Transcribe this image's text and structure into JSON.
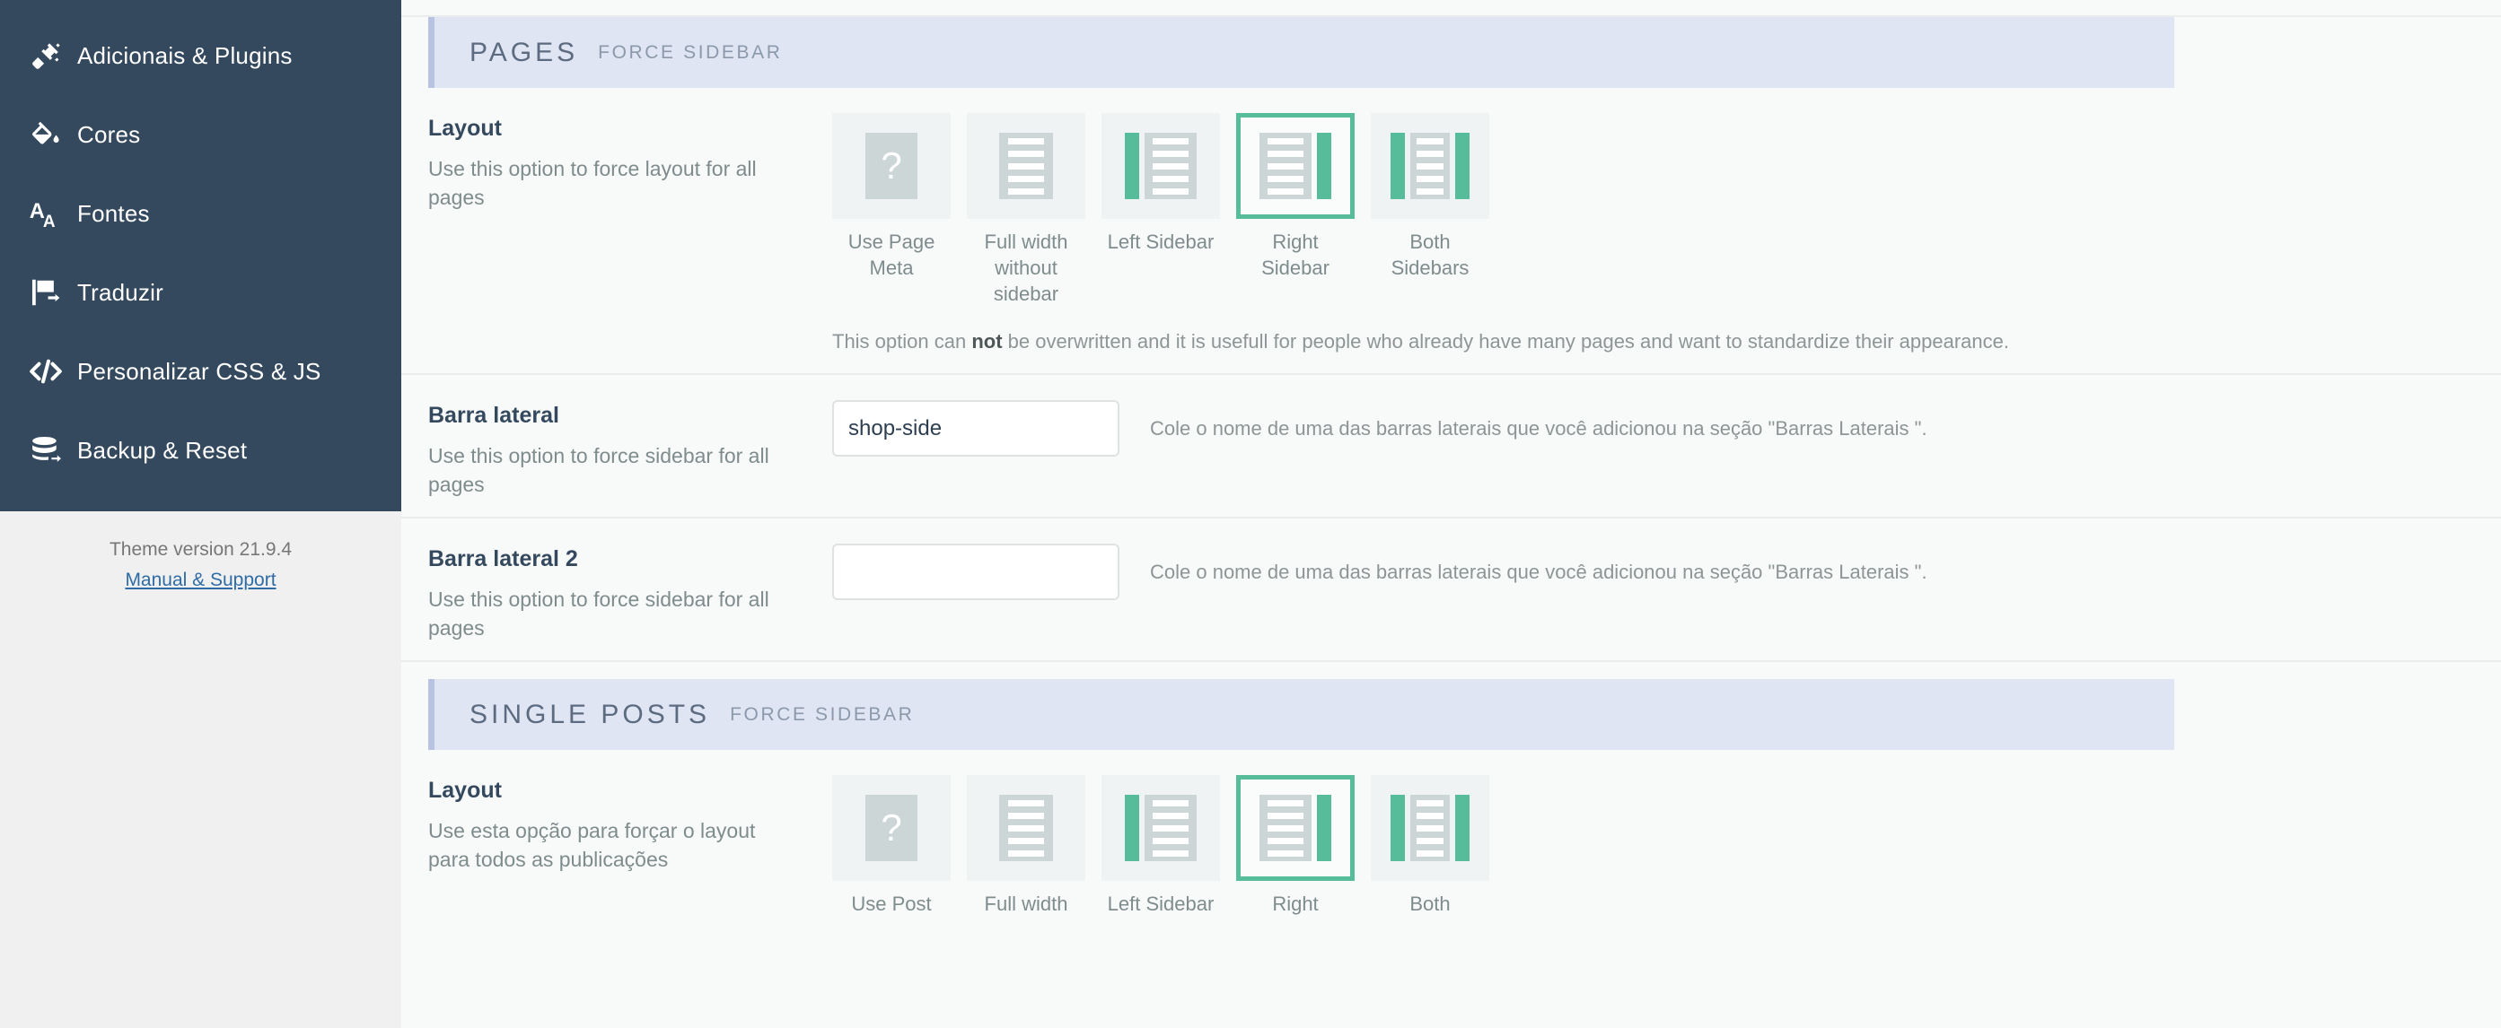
{
  "sidebar": {
    "items": [
      {
        "label": "Adicionais & Plugins",
        "icon": "plug-icon"
      },
      {
        "label": "Cores",
        "icon": "paint-bucket-icon"
      },
      {
        "label": "Fontes",
        "icon": "font-icon"
      },
      {
        "label": "Traduzir",
        "icon": "flag-icon"
      },
      {
        "label": "Personalizar CSS & JS",
        "icon": "code-icon"
      },
      {
        "label": "Backup & Reset",
        "icon": "database-icon"
      }
    ],
    "footer": {
      "version": "Theme version 21.9.4",
      "manual_link": "Manual & Support"
    }
  },
  "colors": {
    "sidebar_bg": "#34495e",
    "accent_green": "#57bc99",
    "section_header_bg": "#dfe5f3",
    "link_blue": "#2f6ca5"
  },
  "sections": [
    {
      "title": "PAGES",
      "subtitle": "FORCE SIDEBAR"
    },
    {
      "title": "SINGLE POSTS",
      "subtitle": "FORCE SIDEBAR"
    }
  ],
  "pages_layout_row": {
    "title": "Layout",
    "description": "Use this option to force layout for all pages",
    "options": [
      {
        "label": "Use Page Meta",
        "art": "question",
        "selected": false
      },
      {
        "label": "Full width without sidebar",
        "art": "full",
        "selected": false
      },
      {
        "label": "Left Sidebar",
        "art": "left",
        "selected": false
      },
      {
        "label": "Right Sidebar",
        "art": "right",
        "selected": true
      },
      {
        "label": "Both Sidebars",
        "art": "both",
        "selected": false
      }
    ],
    "note_prefix": "This option can ",
    "note_bold": "not",
    "note_suffix": " be overwritten and it is usefull for people who already have many pages and want to standardize their appearance."
  },
  "sidebar_row_1": {
    "title": "Barra lateral",
    "description": "Use this option to force sidebar for all pages",
    "value": "shop-side",
    "placeholder": "",
    "help": "Cole o nome de uma das barras laterais que você adicionou na seção \"Barras Laterais \"."
  },
  "sidebar_row_2": {
    "title": "Barra lateral 2",
    "description": "Use this option to force sidebar for all pages",
    "value": "",
    "placeholder": "",
    "help": "Cole o nome de uma das barras laterais que você adicionou na seção \"Barras Laterais \"."
  },
  "posts_layout_row": {
    "title": "Layout",
    "description": "Use esta opção para forçar o layout para todos as publicações",
    "options": [
      {
        "label": "Use Post",
        "art": "question",
        "selected": false
      },
      {
        "label": "Full width",
        "art": "full",
        "selected": false
      },
      {
        "label": "Left Sidebar",
        "art": "left",
        "selected": false
      },
      {
        "label": "Right",
        "art": "right",
        "selected": true
      },
      {
        "label": "Both",
        "art": "both",
        "selected": false
      }
    ]
  }
}
